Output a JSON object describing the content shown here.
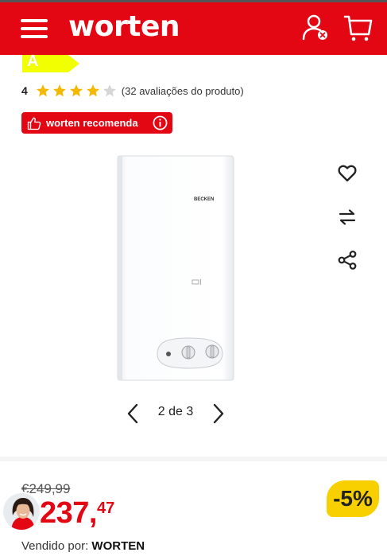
{
  "header": {
    "logo_text": "worten",
    "brand_color": "#e30613",
    "menu_icon": "menu-icon",
    "user_icon": "user-icon",
    "cart_icon": "cart-icon"
  },
  "energy_label": {
    "letter": "A",
    "color": "#f2ff00"
  },
  "rating": {
    "value": "4",
    "stars_filled": 4,
    "stars_total": 5,
    "reviews_text": "(32 avaliações do produto)",
    "star_color": "#f5b800"
  },
  "recommend_badge": {
    "label": "worten recomenda",
    "info_icon": "info-icon"
  },
  "product_image": {
    "brand_text": "BECKEN"
  },
  "actions": {
    "favorite_icon": "heart-icon",
    "compare_icon": "compare-icon",
    "share_icon": "share-icon"
  },
  "gallery": {
    "pager": "2 de 3",
    "current": 2,
    "total": 3
  },
  "pricing": {
    "old_price": "€249,99",
    "price_main": "237,",
    "price_cents": "47",
    "discount": "-5%",
    "discount_color": "#f8d000"
  },
  "seller": {
    "label": "Vendido por:",
    "name": "WORTEN"
  }
}
